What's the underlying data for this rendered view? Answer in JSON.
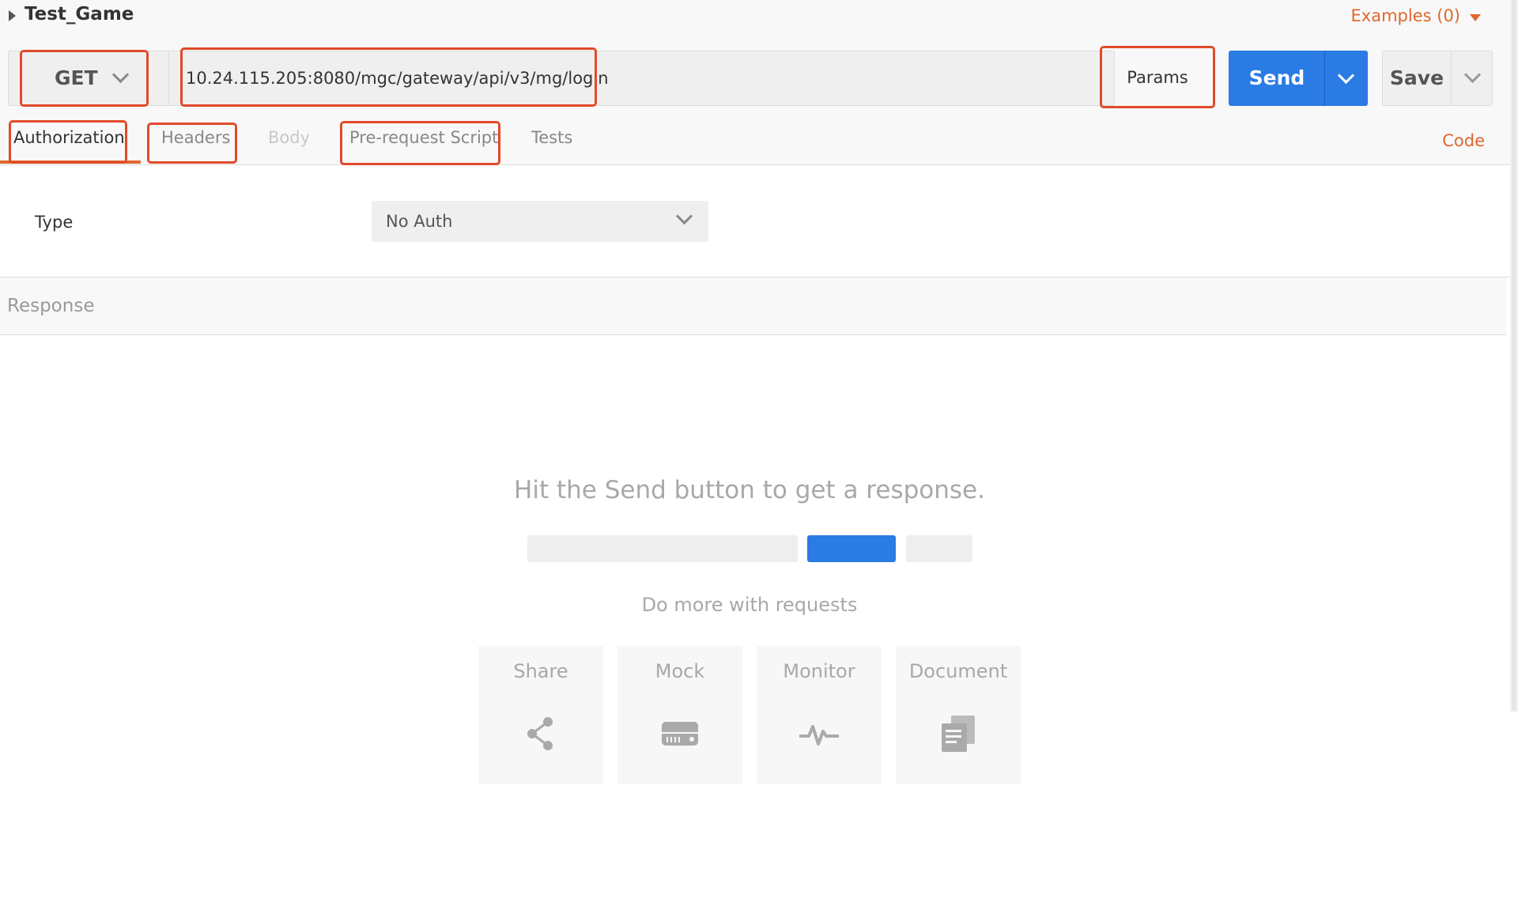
{
  "header": {
    "request_name": "Test_Game",
    "examples_label": "Examples (0)"
  },
  "request": {
    "method": "GET",
    "url": "10.24.115.205:8080/mgc/gateway/api/v3/mg/login",
    "params_label": "Params",
    "send_label": "Send",
    "save_label": "Save"
  },
  "tabs": [
    {
      "label": "Authorization",
      "state": "active"
    },
    {
      "label": "Headers",
      "state": "normal"
    },
    {
      "label": "Body",
      "state": "disabled"
    },
    {
      "label": "Pre-request Script",
      "state": "normal"
    },
    {
      "label": "Tests",
      "state": "normal"
    }
  ],
  "code_label": "Code",
  "auth": {
    "type_label": "Type",
    "type_value": "No Auth"
  },
  "response": {
    "title": "Response",
    "empty_message": "Hit the Send button to get a response.",
    "do_more": "Do more with requests",
    "cards": [
      {
        "label": "Share",
        "icon": "share-icon"
      },
      {
        "label": "Mock",
        "icon": "mock-server-icon"
      },
      {
        "label": "Monitor",
        "icon": "monitor-pulse-icon"
      },
      {
        "label": "Document",
        "icon": "document-icon"
      }
    ]
  },
  "colors": {
    "accent": "#e0682d",
    "primary": "#2a7be4",
    "highlight": "#e04a2a"
  }
}
